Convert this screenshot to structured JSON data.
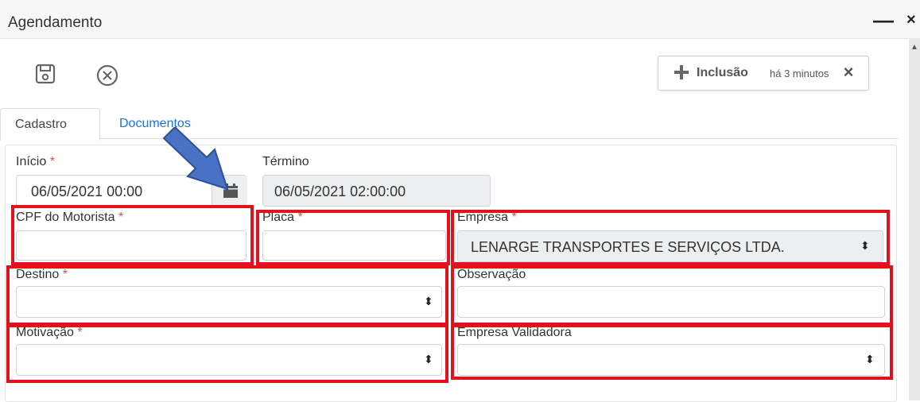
{
  "window": {
    "title": "Agendamento",
    "minimize_glyph": "—",
    "close_glyph": "×"
  },
  "toolbar": {
    "save_icon": "floppy-disk-icon",
    "cancel_icon": "circle-x-icon"
  },
  "toast": {
    "title": "Inclusão",
    "time": "há 3 minutos",
    "close_glyph": "×",
    "icon": "plus-icon"
  },
  "tabs": [
    {
      "label": "Cadastro",
      "active": true
    },
    {
      "label": "Documentos",
      "active": false
    }
  ],
  "form": {
    "inicio": {
      "label": "Início",
      "required": "*",
      "value": "06/05/2021 00:00",
      "icon": "calendar-icon"
    },
    "termino": {
      "label": "Término",
      "value": "06/05/2021 02:00:00"
    },
    "cpf": {
      "label": "CPF do Motorista",
      "required": "*",
      "value": ""
    },
    "placa": {
      "label": "Placa",
      "required": "*",
      "value": ""
    },
    "empresa": {
      "label": "Empresa",
      "required": "*",
      "value": "LENARGE TRANSPORTES E SERVIÇOS LTDA."
    },
    "destino": {
      "label": "Destino",
      "required": "*",
      "value": ""
    },
    "observacao": {
      "label": "Observação",
      "value": ""
    },
    "motivacao": {
      "label": "Motivação",
      "required": "*",
      "value": ""
    },
    "empresa_validadora": {
      "label": "Empresa Validadora",
      "value": ""
    },
    "select_glyph": "⬍"
  },
  "colors": {
    "highlight": "#e1121b",
    "arrow": "#4a72c4",
    "link": "#1a73e8",
    "required": "#d9534f"
  }
}
